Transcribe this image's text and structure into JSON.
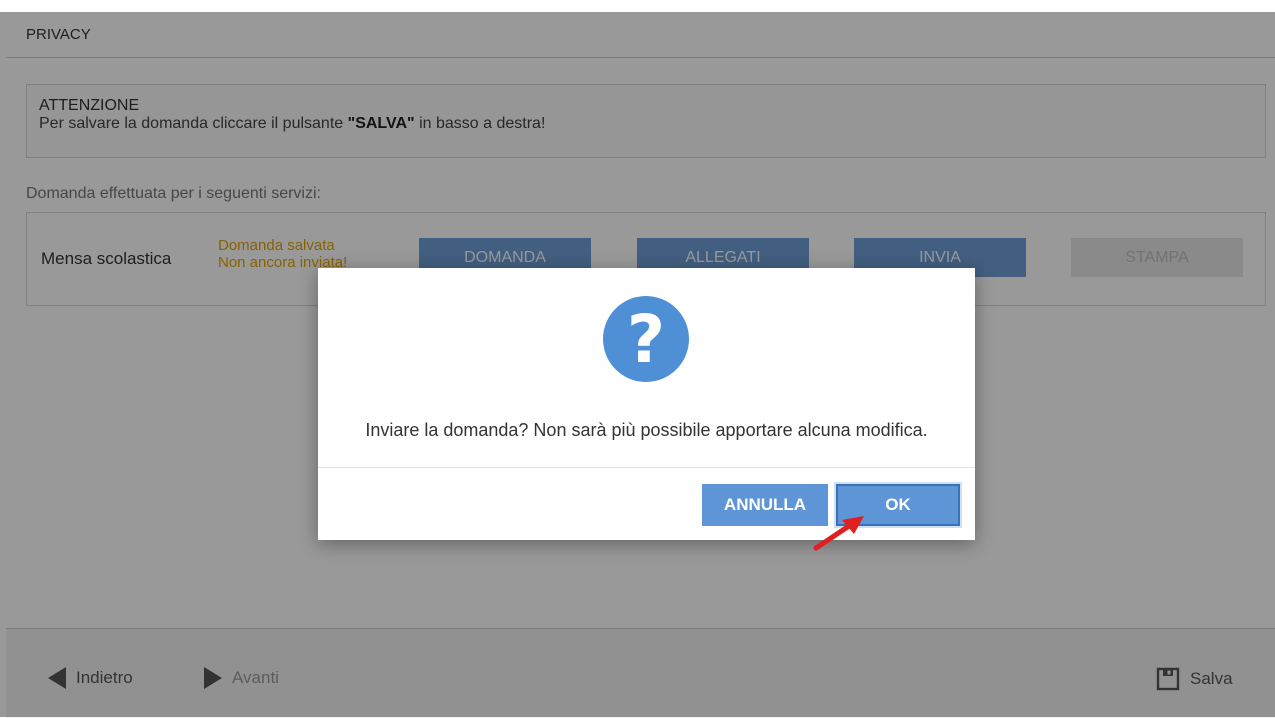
{
  "header": {
    "title": "PRIVACY"
  },
  "alert": {
    "title": "ATTENZIONE",
    "text_before": "Per salvare la domanda cliccare il pulsante ",
    "text_bold": "\"SALVA\"",
    "text_after": " in basso a destra!"
  },
  "services": {
    "label": "Domanda effettuata per i seguenti servizi:",
    "rows": [
      {
        "name": "Mensa scolastica",
        "status_line1": "Domanda salvata",
        "status_line2": "Non ancora inviata!",
        "buttons": [
          "DOMANDA",
          "ALLEGATI",
          "INVIA",
          "STAMPA"
        ]
      }
    ]
  },
  "footer": {
    "back": "Indietro",
    "next": "Avanti",
    "save": "Salva"
  },
  "dialog": {
    "icon": "question-icon",
    "message": "Inviare la domanda? Non sarà più possibile apportare alcuna modifica.",
    "cancel": "ANNULLA",
    "ok": "OK"
  },
  "colors": {
    "primary": "#5d95d6",
    "warning": "#e4a400",
    "annotation_arrow": "#e02020"
  }
}
